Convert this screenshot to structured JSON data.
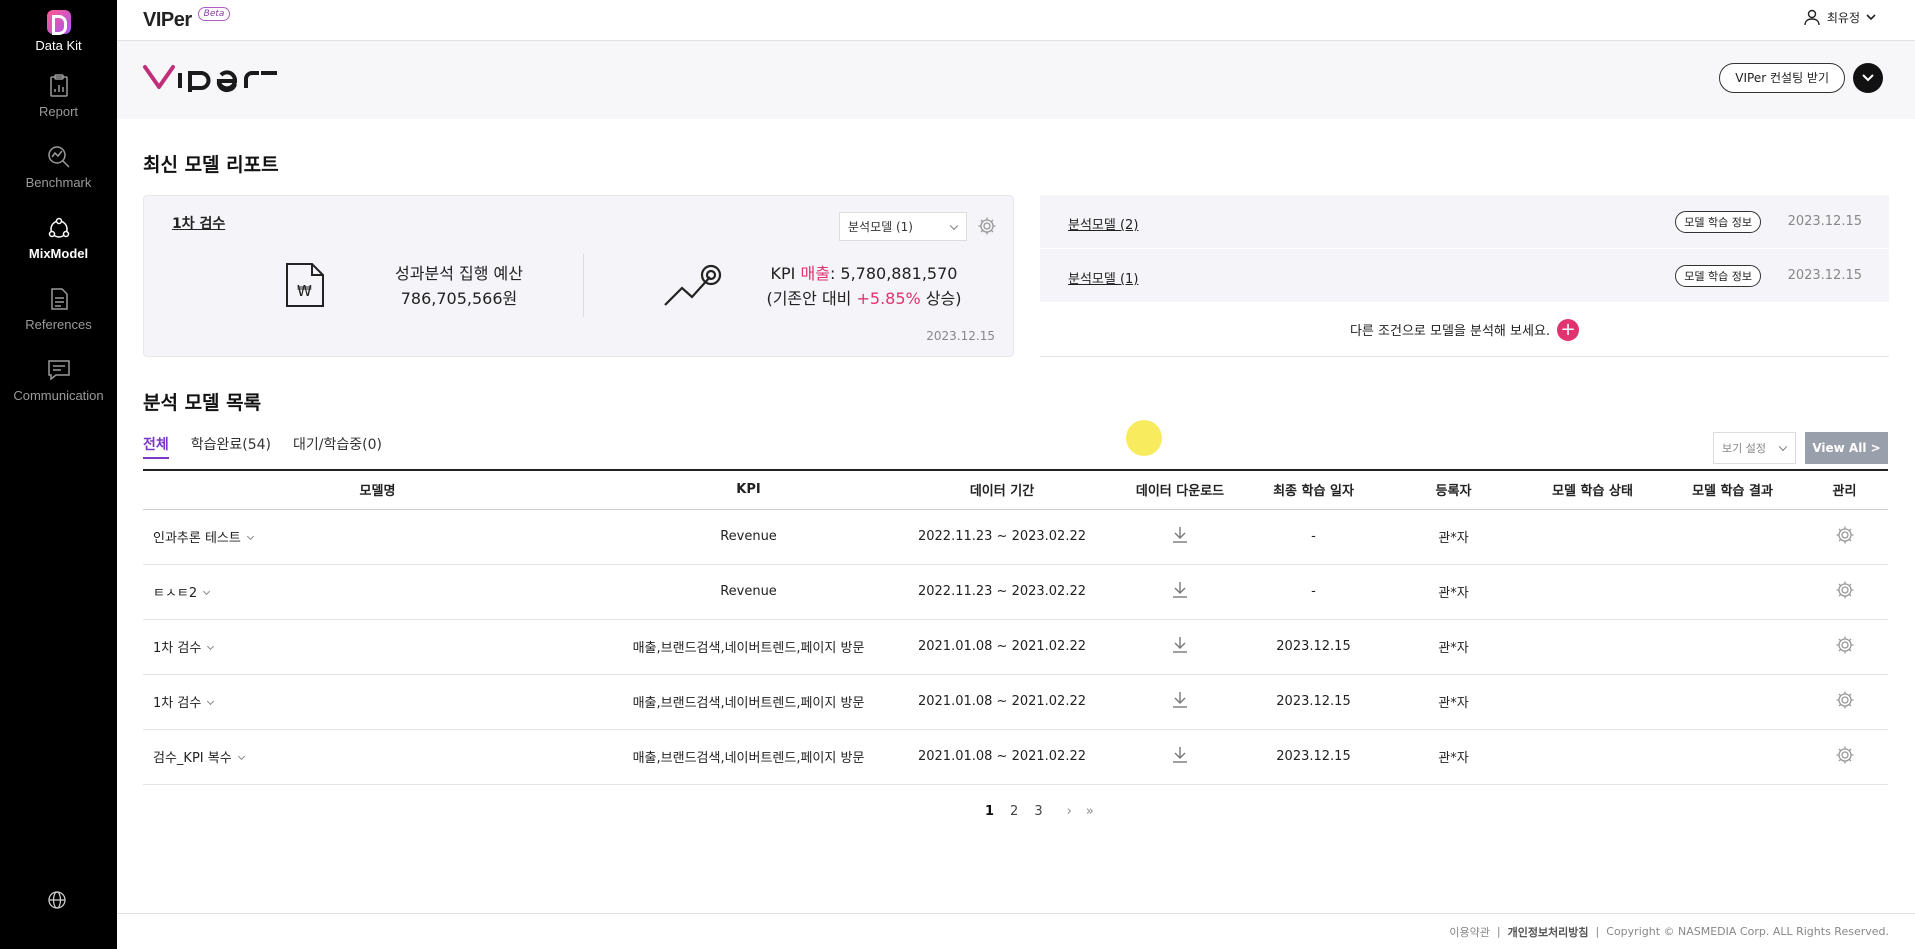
{
  "sidebar": {
    "brand": "Data Kit",
    "items": [
      {
        "label": "Report",
        "active": false
      },
      {
        "label": "Benchmark",
        "active": false
      },
      {
        "label": "MixModel",
        "active": true
      },
      {
        "label": "References",
        "active": false
      },
      {
        "label": "Communication",
        "active": false
      }
    ]
  },
  "header": {
    "app_title": "VIPer",
    "beta_label": "Beta",
    "user_name": "최유정"
  },
  "banner": {
    "consult_button": "VIPer 컨설팅 받기"
  },
  "latest": {
    "title": "최신 모델 리포트",
    "card": {
      "name": "1차 검수",
      "select_value": "분석모델 (1)",
      "budget_label": "성과분석 집행 예산",
      "budget_value": "786,705,566원",
      "kpi_prefix": "KPI",
      "kpi_name": "매출",
      "kpi_value": ": 5,780,881,570",
      "compare_prefix": "(기존안 대비",
      "compare_value": "+5.85%",
      "compare_suffix": "상승)",
      "date": "2023.12.15"
    },
    "models": [
      {
        "name": "분석모델 (2)",
        "info_button": "모델 학습 정보",
        "date": "2023.12.15"
      },
      {
        "name": "분석모델 (1)",
        "info_button": "모델 학습 정보",
        "date": "2023.12.15"
      }
    ],
    "add_prompt": "다른 조건으로 모델을 분석해 보세요.",
    "add_symbol": "+"
  },
  "list": {
    "title": "분석 모델 목록",
    "tabs": [
      "전체",
      "학습완료(54)",
      "대기/학습중(0)"
    ],
    "view_setting": "보기 설정",
    "view_all": "View All >",
    "columns": [
      "모델명",
      "KPI",
      "데이터 기간",
      "데이터 다운로드",
      "최종 학습 일자",
      "등록자",
      "모델 학습 상태",
      "모델 학습 결과",
      "관리"
    ],
    "rows": [
      {
        "name": "인과추론 테스트",
        "kpi": "Revenue",
        "period": "2022.11.23 ~ 2023.02.22",
        "last": "-",
        "owner": "관*자"
      },
      {
        "name": "ㅌㅅㅌ2",
        "kpi": "Revenue",
        "period": "2022.11.23 ~ 2023.02.22",
        "last": "-",
        "owner": "관*자"
      },
      {
        "name": "1차 검수",
        "kpi": "매출,브랜드검색,네이버트렌드,페이지 방문",
        "period": "2021.01.08 ~ 2021.02.22",
        "last": "2023.12.15",
        "owner": "관*자"
      },
      {
        "name": "1차 검수",
        "kpi": "매출,브랜드검색,네이버트렌드,페이지 방문",
        "period": "2021.01.08 ~ 2021.02.22",
        "last": "2023.12.15",
        "owner": "관*자"
      },
      {
        "name": "검수_KPI 복수",
        "kpi": "매출,브랜드검색,네이버트렌드,페이지 방문",
        "period": "2021.01.08 ~ 2021.02.22",
        "last": "2023.12.15",
        "owner": "관*자"
      }
    ],
    "pages": [
      "1",
      "2",
      "3"
    ],
    "next": "›",
    "last": "»"
  },
  "footer": {
    "terms": "이용약관",
    "privacy": "개인정보처리방침",
    "copyright": "Copyright © NASMEDIA Corp. ALL Rights Reserved."
  },
  "colors": {
    "accent_purple": "#7a38c9",
    "accent_pink": "#e0336f"
  }
}
